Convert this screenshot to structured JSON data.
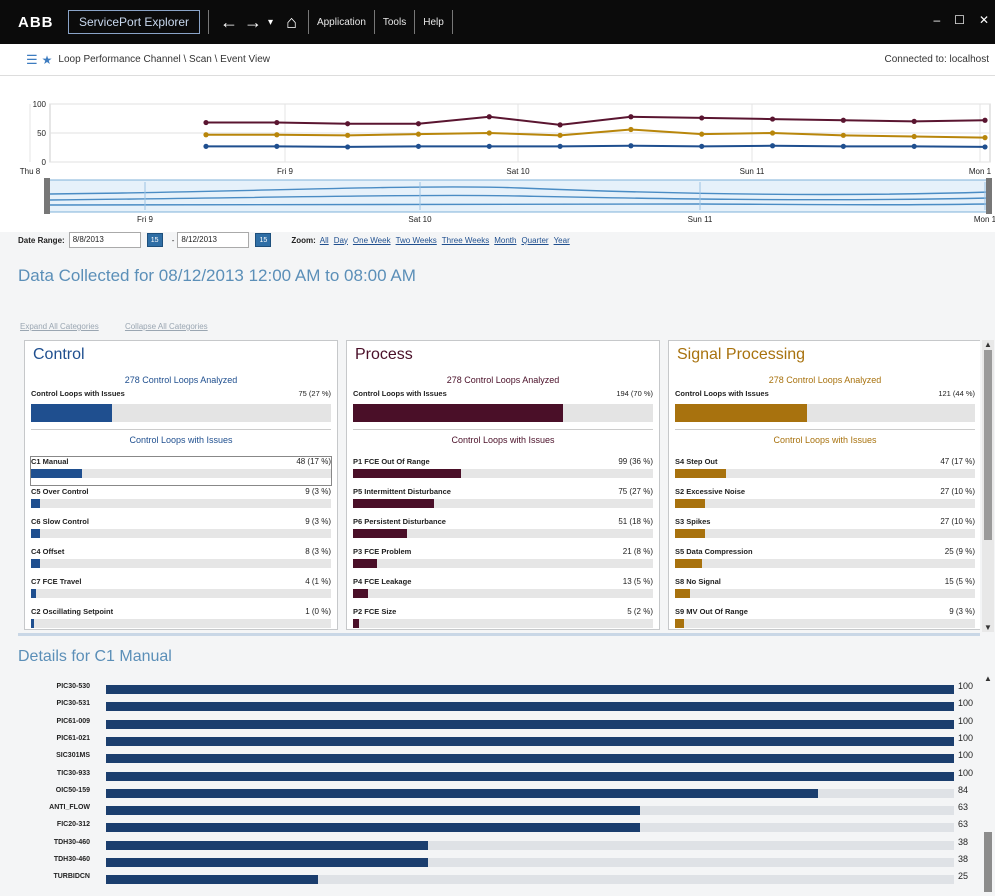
{
  "titlebar": {
    "logo": "ABB",
    "app_title": "ServicePort Explorer",
    "menu": [
      "Application",
      "Tools",
      "Help"
    ],
    "win_controls": [
      "–",
      "☐",
      "✕"
    ]
  },
  "breadcrumb": {
    "path": "Loop Performance Channel \\ Scan \\ Event View",
    "connection": "Connected to: localhost"
  },
  "timeline": {
    "y_ticks": [
      "100",
      "50",
      "0"
    ],
    "x_labels": [
      "Thu 8",
      "Fri 9",
      "Sat 10",
      "Sun 11",
      "Mon 1"
    ],
    "nav_labels": [
      "Fri 9",
      "Sat 10",
      "Sun 11",
      "Mon 1"
    ],
    "colors": {
      "control": "#1f4f8f",
      "process": "#5a1530",
      "signal": "#b8860b"
    }
  },
  "chart_data": {
    "type": "line",
    "x": [
      0,
      1,
      2,
      3,
      4,
      5,
      6,
      7,
      8,
      9,
      10,
      11
    ],
    "ylim": [
      0,
      100
    ],
    "series": [
      {
        "values": [
          68,
          68,
          66,
          66,
          78,
          64,
          78,
          76,
          74,
          72,
          70,
          72
        ]
      },
      {
        "values": [
          47,
          47,
          46,
          48,
          50,
          46,
          56,
          48,
          50,
          46,
          44,
          42
        ]
      },
      {
        "values": [
          27,
          27,
          26,
          27,
          27,
          27,
          28,
          27,
          28,
          27,
          27,
          26
        ]
      }
    ]
  },
  "date_range": {
    "label": "Date Range:",
    "from": "8/8/2013",
    "to": "8/12/2013",
    "zoom_label": "Zoom:",
    "zoom_options": [
      "All",
      "Day",
      "One Week",
      "Two Weeks",
      "Three Weeks",
      "Month",
      "Quarter",
      "Year"
    ]
  },
  "data_heading": "Data Collected for 08/12/2013 12:00 AM to 08:00 AM",
  "category_links": [
    "Expand All Categories",
    "Collapse All Categories"
  ],
  "panels": [
    {
      "title": "Control",
      "color": "#1f4f8f",
      "analyzed": "278 Control Loops Analyzed",
      "issues_label": "Control Loops with Issues",
      "issues_value": "75 (27 %)",
      "issues_fraction": 0.27,
      "sub_header": "Control Loops with Issues",
      "rows": [
        {
          "label": "C1 Manual",
          "value": "48 (17 %)",
          "fraction": 0.17
        },
        {
          "label": "C5 Over Control",
          "value": "9 (3 %)",
          "fraction": 0.03
        },
        {
          "label": "C6 Slow Control",
          "value": "9 (3 %)",
          "fraction": 0.03
        },
        {
          "label": "C4 Offset",
          "value": "8 (3 %)",
          "fraction": 0.03
        },
        {
          "label": "C7 FCE Travel",
          "value": "4 (1 %)",
          "fraction": 0.015
        },
        {
          "label": "C2 Oscillating Setpoint",
          "value": "1 (0 %)",
          "fraction": 0.004
        }
      ]
    },
    {
      "title": "Process",
      "color": "#4a0f28",
      "analyzed": "278 Control Loops Analyzed",
      "issues_label": "Control Loops with Issues",
      "issues_value": "194 (70 %)",
      "issues_fraction": 0.7,
      "sub_header": "Control Loops with Issues",
      "rows": [
        {
          "label": "P1 FCE Out Of Range",
          "value": "99 (36 %)",
          "fraction": 0.36
        },
        {
          "label": "P5 Intermittent Disturbance",
          "value": "75 (27 %)",
          "fraction": 0.27
        },
        {
          "label": "P6 Persistent Disturbance",
          "value": "51 (18 %)",
          "fraction": 0.18
        },
        {
          "label": "P3 FCE Problem",
          "value": "21 (8 %)",
          "fraction": 0.08
        },
        {
          "label": "P4 FCE Leakage",
          "value": "13 (5 %)",
          "fraction": 0.05
        },
        {
          "label": "P2 FCE Size",
          "value": "5 (2 %)",
          "fraction": 0.02
        }
      ]
    },
    {
      "title": "Signal Processing",
      "color": "#a8720e",
      "analyzed": "278 Control Loops Analyzed",
      "issues_label": "Control Loops with Issues",
      "issues_value": "121 (44 %)",
      "issues_fraction": 0.44,
      "sub_header": "Control Loops with Issues",
      "rows": [
        {
          "label": "S4 Step Out",
          "value": "47 (17 %)",
          "fraction": 0.17
        },
        {
          "label": "S2 Excessive Noise",
          "value": "27 (10 %)",
          "fraction": 0.1
        },
        {
          "label": "S3 Spikes",
          "value": "27 (10 %)",
          "fraction": 0.1
        },
        {
          "label": "S5 Data Compression",
          "value": "25 (9 %)",
          "fraction": 0.09
        },
        {
          "label": "S8 No Signal",
          "value": "15 (5 %)",
          "fraction": 0.05
        },
        {
          "label": "S9 MV Out Of Range",
          "value": "9 (3 %)",
          "fraction": 0.03
        }
      ]
    }
  ],
  "details": {
    "heading": "Details for C1 Manual",
    "rows": [
      {
        "label": "PIC30-530",
        "value": "100"
      },
      {
        "label": "PIC30-531",
        "value": "100"
      },
      {
        "label": "PIC61-009",
        "value": "100"
      },
      {
        "label": "PIC61-021",
        "value": "100"
      },
      {
        "label": "SIC301MS",
        "value": "100"
      },
      {
        "label": "TIC30-933",
        "value": "100"
      },
      {
        "label": "OIC50-159",
        "value": "84"
      },
      {
        "label": "ANTI_FLOW",
        "value": "63"
      },
      {
        "label": "FIC20-312",
        "value": "63"
      },
      {
        "label": "TDH30-460",
        "value": "38"
      },
      {
        "label": "TDH30-460",
        "value": "38"
      },
      {
        "label": "TURBIDCN",
        "value": "25"
      }
    ]
  }
}
